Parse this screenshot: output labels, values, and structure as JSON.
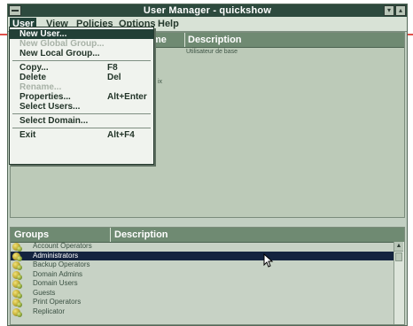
{
  "window": {
    "title": "User Manager - quickshow"
  },
  "titlebar": {
    "minimize_glyph": "▾",
    "maximize_glyph": "▴"
  },
  "menubar": {
    "items": [
      {
        "label": "User",
        "active": true
      },
      {
        "label": "View"
      },
      {
        "label": "Policies"
      },
      {
        "label": "Options"
      },
      {
        "label": "Help"
      }
    ]
  },
  "user_menu": {
    "items": [
      {
        "label": "New User...",
        "highlighted": true
      },
      {
        "label": "New Global Group...",
        "disabled": true
      },
      {
        "label": "New Local Group..."
      },
      {
        "separator": true
      },
      {
        "label": "Copy...",
        "shortcut": "F8"
      },
      {
        "label": "Delete",
        "shortcut": "Del"
      },
      {
        "label": "Rename...",
        "disabled": true
      },
      {
        "label": "Properties...",
        "shortcut": "Alt+Enter"
      },
      {
        "label": "Select Users..."
      },
      {
        "separator": true
      },
      {
        "label": "Select Domain..."
      },
      {
        "separator": true
      },
      {
        "label": "Exit",
        "shortcut": "Alt+F4"
      }
    ]
  },
  "users_pane": {
    "header": {
      "name_fragment": "me",
      "description": "Description"
    },
    "visible_cells": {
      "description_row1": "Utilisateur de base",
      "fragment": "ix"
    }
  },
  "groups_pane": {
    "header": {
      "groups": "Groups",
      "description": "Description"
    },
    "items": [
      {
        "name": "Account Operators"
      },
      {
        "name": "Administrators",
        "selected": true
      },
      {
        "name": "Backup Operators"
      },
      {
        "name": "Domain Admins"
      },
      {
        "name": "Domain Users"
      },
      {
        "name": "Guests"
      },
      {
        "name": "Print Operators"
      },
      {
        "name": "Replicator"
      }
    ],
    "scroll_up_glyph": "▲"
  },
  "colors": {
    "titlebar": "#2d4a3e",
    "menu_highlight": "#223f36",
    "selection": "#14233f",
    "window_bg": "#c2cfc2",
    "pane_header": "#6f8a72"
  }
}
